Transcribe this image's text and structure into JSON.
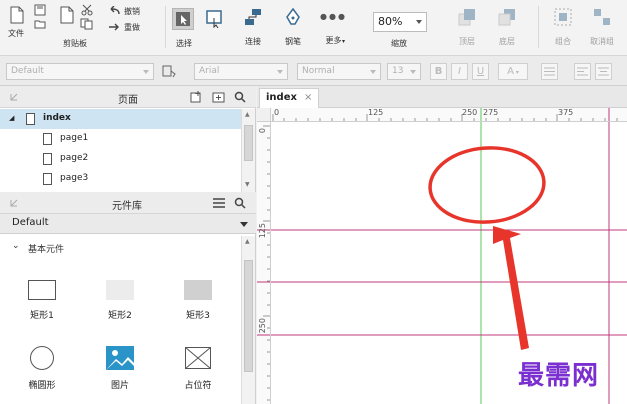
{
  "toolbar": {
    "file": "文件",
    "clipboard": "剪贴板",
    "undo": "撤销",
    "redo": "重做",
    "select": "选择",
    "connect": "连接",
    "pen": "钢笔",
    "more": "更多",
    "more_dots": "●●●",
    "zoom_value": "80%",
    "zoom_label": "缩放",
    "top": "顶层",
    "bottom": "底层",
    "group": "组合",
    "ungroup": "取消组"
  },
  "stylebar": {
    "style": "Default",
    "font": "Arial",
    "weight": "Normal",
    "size": "13",
    "bold": "B",
    "italic": "I",
    "underline": "U",
    "color": "A"
  },
  "pages_panel": {
    "title": "页面",
    "pages": [
      "index",
      "page1",
      "page2",
      "page3"
    ]
  },
  "library_panel": {
    "title": "元件库",
    "library": "Default",
    "category": "基本元件",
    "widgets": [
      "矩形1",
      "矩形2",
      "矩形3",
      "椭圆形",
      "图片",
      "占位符"
    ]
  },
  "canvas": {
    "tab": "index",
    "tab_close": "×",
    "h_ruler": [
      "0",
      "125",
      "250",
      "275",
      "375"
    ],
    "v_ruler": [
      "0",
      "125",
      "250"
    ]
  },
  "watermark": "最需网",
  "colors": {
    "selected_row": "#cfe4f3",
    "guide_magenta": "#c2387a",
    "guide_green": "#5ac85a",
    "annotation_red": "#e8352b",
    "watermark": "#7b2fd0"
  }
}
